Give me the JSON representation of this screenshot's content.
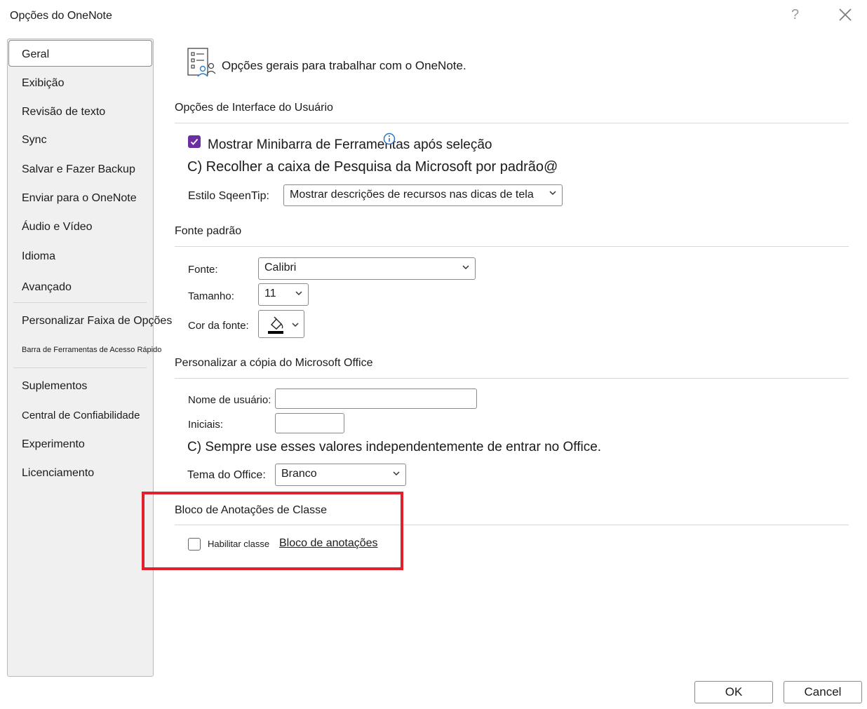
{
  "window": {
    "title": "Opções do OneNote",
    "help": "?"
  },
  "sidebar": {
    "items": [
      {
        "label": "Geral"
      },
      {
        "label": "Exibição"
      },
      {
        "label": "Revisão de texto"
      },
      {
        "label": "Sync"
      },
      {
        "label": "Salvar e Fazer Backup"
      },
      {
        "label": "Enviar para o OneNote"
      },
      {
        "label": "Áudio e Vídeo"
      },
      {
        "label": "Idioma"
      },
      {
        "label": "Avançado"
      },
      {
        "label": "Personalizar Faixa de Opções"
      },
      {
        "label": "Barra de Ferramentas de Acesso Rápido"
      },
      {
        "label": "Suplementos"
      },
      {
        "label": "Central de Confiabilidade"
      },
      {
        "label": "Experimento"
      },
      {
        "label": "Licenciamento"
      }
    ],
    "selected": "Geral"
  },
  "header": {
    "text": "Opções gerais para trabalhar com o OneNote."
  },
  "ui_options": {
    "title": "Opções de Interface do Usuário",
    "minibar_label": "Mostrar Minibarra de Ferramentas após seleção",
    "minibar_checked": true,
    "collapse_text": "C) Recolher a caixa de Pesquisa da Microsoft por padrão@",
    "screentip_label": "Estilo SqeenTip:",
    "screentip_value": "Mostrar descrições de recursos nas dicas de tela"
  },
  "default_font": {
    "title": "Fonte padrão",
    "font_label": "Fonte:",
    "font_value": "Calibri",
    "size_label": "Tamanho:",
    "size_value": "11",
    "color_label": "Cor da fonte:"
  },
  "personalize": {
    "title": "Personalizar a cópia do Microsoft Office",
    "username_label": "Nome de usuário:",
    "username_value": "",
    "initials_label": "Iniciais:",
    "initials_value": "",
    "always_text": "C) Sempre use esses valores independentemente de entrar no Office.",
    "theme_label": "Tema do Office:",
    "theme_value": "Branco"
  },
  "class_notebook": {
    "title": "Bloco de Anotações de Classe",
    "enable_label": "Habilitar classe",
    "enable_link": "Bloco de anotações",
    "enabled": false
  },
  "footer": {
    "ok_label": "OK",
    "cancel_label": "Cancel"
  },
  "colors": {
    "accent": "#6b2fa0",
    "highlight": "#e0202a"
  }
}
